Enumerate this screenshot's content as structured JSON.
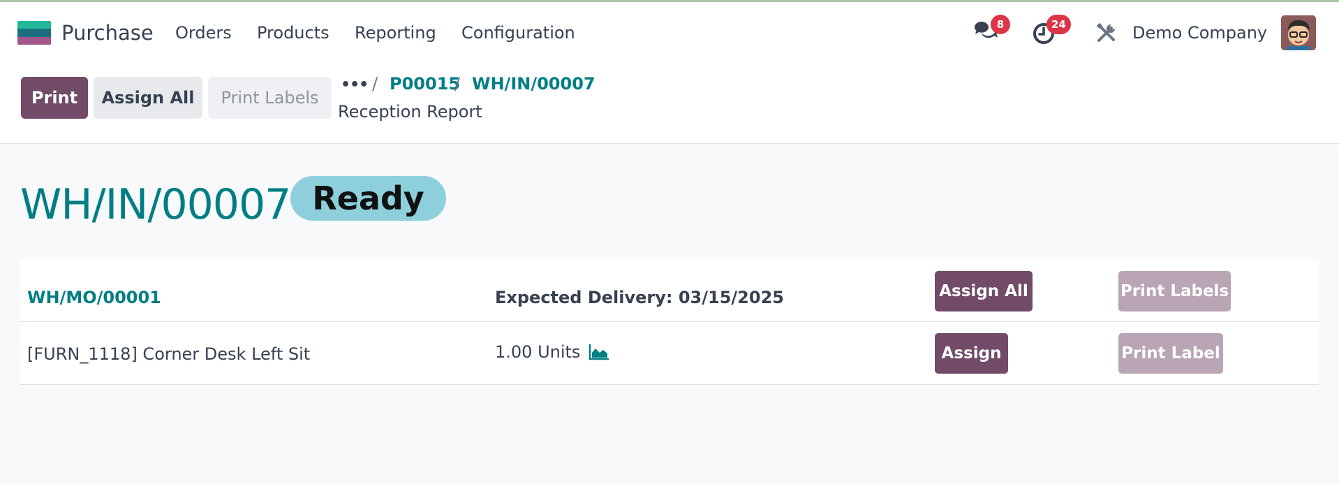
{
  "navbar": {
    "app_name": "Purchase",
    "menu": [
      "Orders",
      "Products",
      "Reporting",
      "Configuration"
    ],
    "messages_badge": "8",
    "activities_badge": "24",
    "company": "Demo Company"
  },
  "control_panel": {
    "buttons": {
      "print": "Print",
      "assign_all": "Assign All",
      "print_labels": "Print Labels"
    },
    "breadcrumb": {
      "more": "•••",
      "separator": "/",
      "items": [
        "P00015",
        "WH/IN/00007"
      ],
      "current": "Reception Report"
    }
  },
  "report": {
    "title": "WH/IN/00007",
    "state": "Ready",
    "group": {
      "source": "WH/MO/00001",
      "expected_delivery": "Expected Delivery: 03/15/2025",
      "assign_all_label": "Assign All",
      "print_labels_label": "Print Labels"
    },
    "lines": [
      {
        "product": "[FURN_1118] Corner Desk Left Sit",
        "quantity": "1.00 Units",
        "assign_label": "Assign",
        "print_label": "Print Label"
      }
    ]
  },
  "colors": {
    "brand": "#714b67",
    "link": "#017e84",
    "state_ready": "#8dd0dc",
    "badge": "#dc3545"
  },
  "icons": [
    "chat-icon",
    "activity-clock-icon",
    "tools-icon",
    "forecast-chart-icon"
  ]
}
